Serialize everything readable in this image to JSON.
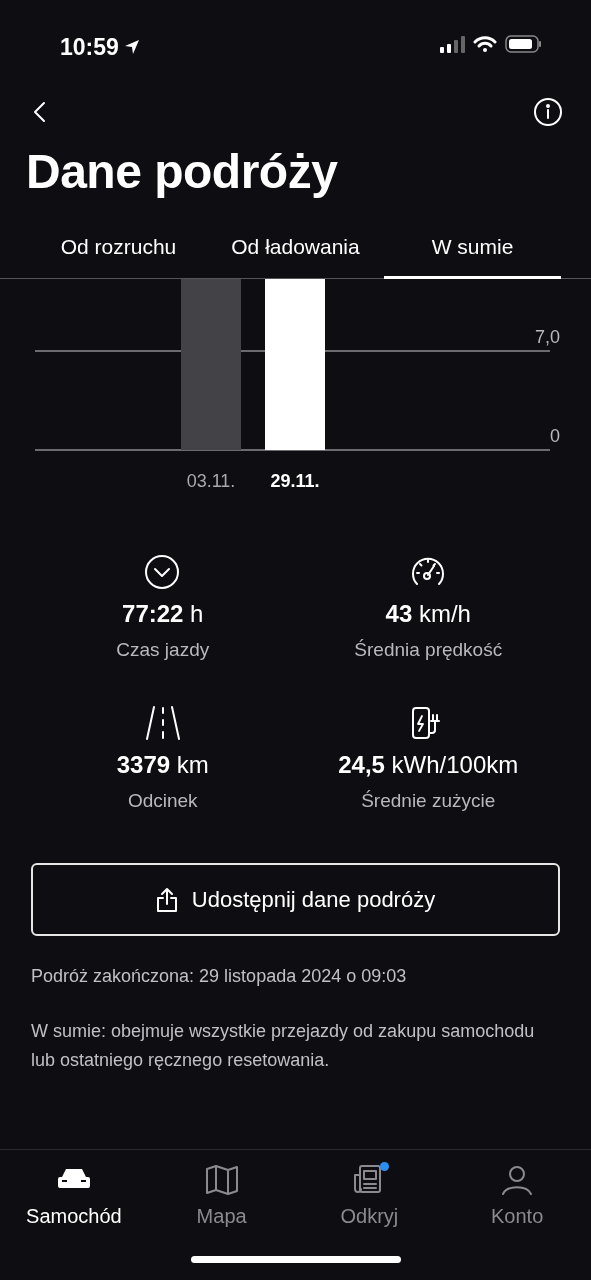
{
  "status_bar": {
    "time": "10:59"
  },
  "title": "Dane podróży",
  "tabs": [
    {
      "label": "Od rozruchu",
      "selected": false
    },
    {
      "label": "Od ładowania",
      "selected": false
    },
    {
      "label": "W sumie",
      "selected": true
    }
  ],
  "chart": {
    "gridlines": [
      {
        "label": "7,0"
      },
      {
        "label": "0"
      }
    ],
    "bars": [
      {
        "label": "03.11.",
        "selected": false
      },
      {
        "label": "29.11.",
        "selected": true
      }
    ]
  },
  "stats": [
    {
      "kind": "duration",
      "value": "**77:22** h",
      "label": "Czas jazdy"
    },
    {
      "kind": "speed",
      "value": "**43** km/h",
      "label": "Średnia prędkość"
    },
    {
      "kind": "distance",
      "value": "**3379** km",
      "label": "Odcinek"
    },
    {
      "kind": "consumption",
      "value": "**24,5** kWh/100km",
      "label": "Średnie zużycie"
    }
  ],
  "share_button": "Udostępnij dane podróży",
  "trip_end": "Podróż zakończona: 29 listopada 2024 o 09:03",
  "note": "W sumie: obejmuje wszystkie przejazdy od zakupu samochodu lub ostatniego ręcznego resetowania.",
  "nav": [
    {
      "kind": "car",
      "label": "Samochód",
      "selected": true,
      "notification": false
    },
    {
      "kind": "map",
      "label": "Mapa",
      "selected": false,
      "notification": false
    },
    {
      "kind": "news",
      "label": "Odkryj",
      "selected": false,
      "notification": true
    },
    {
      "kind": "person",
      "label": "Konto",
      "selected": false,
      "notification": false
    }
  ]
}
